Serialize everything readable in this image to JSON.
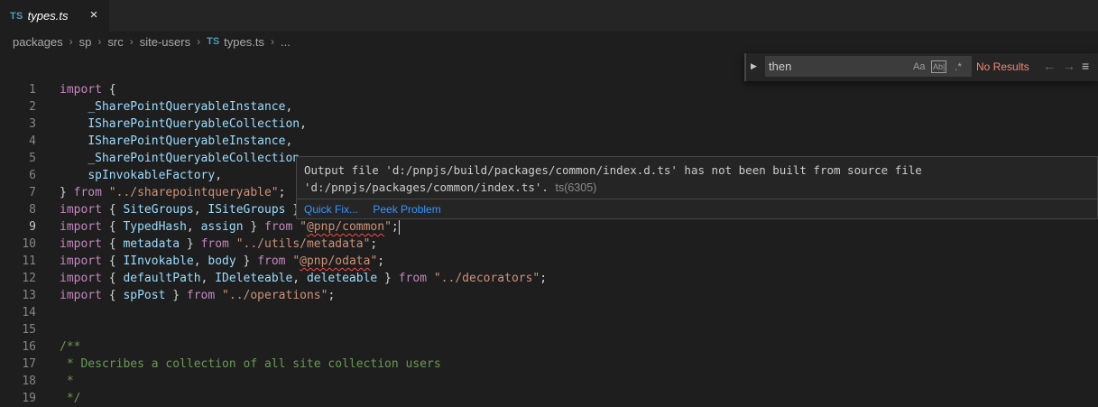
{
  "tab": {
    "lang": "TS",
    "title": "types.ts",
    "close": "×"
  },
  "breadcrumb": [
    "packages",
    "sp",
    "src",
    "site-users",
    "types.ts",
    "..."
  ],
  "breadcrumb_lang": "TS",
  "find": {
    "query": "then",
    "match_case": "Aa",
    "whole_word": "Ab|",
    "regex": ".*",
    "status": "No Results",
    "prev": "←",
    "next": "→",
    "selection": "≡",
    "toggle": "▶"
  },
  "editor": {
    "line_numbers": [
      "1",
      "2",
      "3",
      "4",
      "5",
      "6",
      "7",
      "8",
      "9",
      "10",
      "11",
      "12",
      "13",
      "14",
      "15",
      "16",
      "17",
      "18",
      "19"
    ],
    "active_line": "9"
  },
  "hover": {
    "line1": "Output file 'd:/pnpjs/build/packages/common/index.d.ts' has not been built from source file",
    "line2": "'d:/pnpjs/packages/common/index.ts'.",
    "code": "ts(6305)",
    "quick_fix": "Quick Fix...",
    "peek_problem": "Peek Problem"
  },
  "colors": {
    "keyword": "#c586c0",
    "identifier": "#9cdcfe",
    "string": "#ce9178",
    "comment": "#6a9955",
    "error": "#f48771",
    "link": "#3794ff"
  }
}
